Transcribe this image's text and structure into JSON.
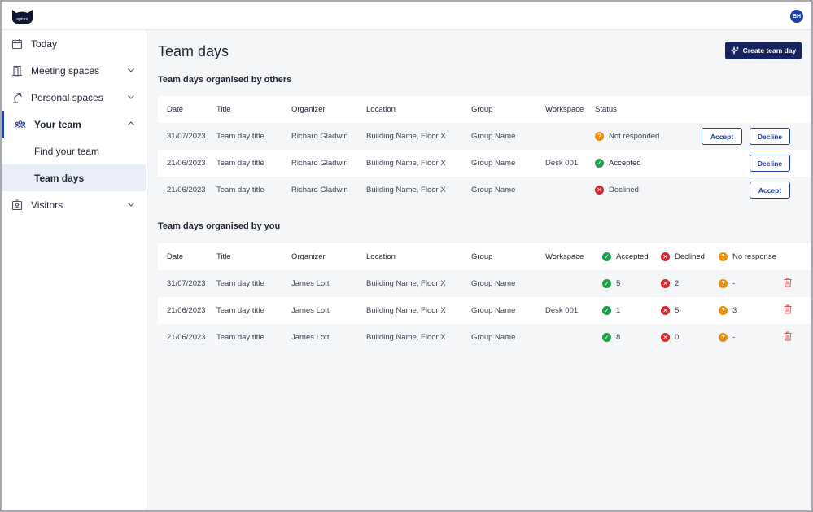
{
  "app": {
    "logo_text": "eptura",
    "user_initials": "BH"
  },
  "sidebar": {
    "items": [
      {
        "label": "Today",
        "icon": "calendar-icon"
      },
      {
        "label": "Meeting spaces",
        "icon": "door-icon"
      },
      {
        "label": "Personal spaces",
        "icon": "desk-lamp-icon"
      },
      {
        "label": "Your team",
        "icon": "team-icon"
      },
      {
        "label": "Visitors",
        "icon": "visitor-badge-icon"
      }
    ],
    "sub_items": [
      {
        "label": "Find your team"
      },
      {
        "label": "Team days"
      }
    ]
  },
  "main": {
    "title": "Team days",
    "create_button": "Create team day",
    "others": {
      "title": "Team days organised by others",
      "headers": [
        "Date",
        "Title",
        "Organizer",
        "Location",
        "Group",
        "Workspace",
        "Status"
      ],
      "rows": [
        {
          "date": "31/07/2023",
          "title": "Team day title",
          "organizer": "Richard Gladwin",
          "location": "Building Name, Floor X",
          "group": "Group Name",
          "workspace": "",
          "status": "Not responded",
          "accept": "Accept",
          "decline": "Decline"
        },
        {
          "date": "21/06/2023",
          "title": "Team day title",
          "organizer": "Richard Gladwin",
          "location": "Building Name, Floor X",
          "group": "Group Name",
          "workspace": "Desk 001",
          "status": "Accepted",
          "decline": "Decline"
        },
        {
          "date": "21/06/2023",
          "title": "Team day title",
          "organizer": "Richard Gladwin",
          "location": "Building Name, Floor X",
          "group": "Group Name",
          "workspace": "",
          "status": "Declined",
          "accept": "Accept"
        }
      ]
    },
    "yours": {
      "title": "Team days organised by you",
      "headers": [
        "Date",
        "Title",
        "Organizer",
        "Location",
        "Group",
        "Workspace",
        "Accepted",
        "Declined",
        "No response"
      ],
      "rows": [
        {
          "date": "31/07/2023",
          "title": "Team day title",
          "organizer": "James Lott",
          "location": "Building Name, Floor X",
          "group": "Group Name",
          "workspace": "",
          "accepted": "5",
          "declined": "2",
          "no_response": "-"
        },
        {
          "date": "21/06/2023",
          "title": "Team day title",
          "organizer": "James Lott",
          "location": "Building Name, Floor X",
          "group": "Group Name",
          "workspace": "Desk 001",
          "accepted": "1",
          "declined": "5",
          "no_response": "3"
        },
        {
          "date": "21/06/2023",
          "title": "Team day title",
          "organizer": "James Lott",
          "location": "Building Name, Floor X",
          "group": "Group Name",
          "workspace": "",
          "accepted": "8",
          "declined": "0",
          "no_response": "-"
        }
      ]
    }
  },
  "colors": {
    "accent": "#1f3ea8",
    "primary_button": "#17235f",
    "accepted": "#1e9e4b",
    "declined": "#d7282f",
    "pending": "#f08c00"
  }
}
